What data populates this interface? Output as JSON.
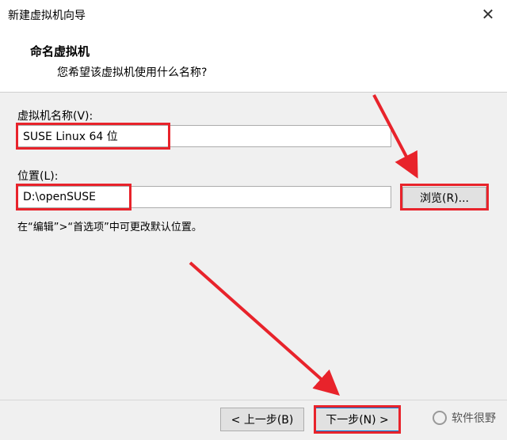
{
  "window": {
    "title": "新建虚拟机向导",
    "close_glyph": "✕"
  },
  "header": {
    "heading": "命名虚拟机",
    "subheading": "您希望该虚拟机使用什么名称?"
  },
  "form": {
    "name_label": "虚拟机名称(V):",
    "name_value": "SUSE Linux 64 位",
    "location_label": "位置(L):",
    "location_value": "D:\\openSUSE",
    "browse_label": "浏览(R)...",
    "hint": "在“编辑”>“首选项”中可更改默认位置。"
  },
  "footer": {
    "back_label": "< 上一步(B)",
    "next_label": "下一步(N) >"
  },
  "watermark": {
    "text": "软件很野"
  },
  "colors": {
    "annotation": "#e8232b"
  }
}
